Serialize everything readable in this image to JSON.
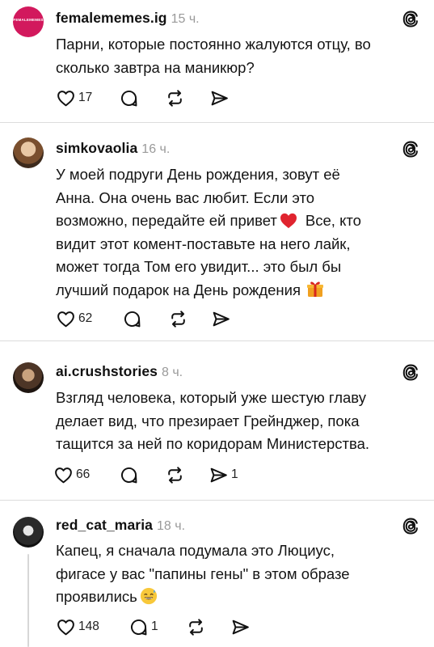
{
  "posts": [
    {
      "username": "femalememes.ig",
      "time": "15 ч.",
      "avatar_text": "FEMALEMEMES",
      "lines": [
        "Парни, которые постоянно жалуются отцу, во",
        "сколько завтра на маникюр?"
      ],
      "likes": "17",
      "replies": "",
      "reposts": "",
      "shares": ""
    },
    {
      "username": "simkovaolia",
      "time": "16 ч.",
      "lines": [
        "У моей подруги День рождения, зовут её",
        "Анна. Она очень вас любит. Если это",
        "возможно, передайте ей привет",
        "видит этот комент-поставьте на него лайк,",
        "может тогда Том его увидит... это был бы",
        "лучший подарок на День рождения"
      ],
      "line3_tail": "Все, кто",
      "likes": "62",
      "replies": "",
      "reposts": "",
      "shares": ""
    },
    {
      "username": "ai.crushstories",
      "time": "8 ч.",
      "lines": [
        "Взгляд человека, который уже шестую главу",
        "делает вид, что презирает Грейнджер, пока",
        "тащится за ней по коридорам Министерства."
      ],
      "likes": "66",
      "replies": "",
      "reposts": "",
      "shares": "1"
    },
    {
      "username": "red_cat_maria",
      "time": "18 ч.",
      "lines": [
        "Капец, я сначала подумала это Люциус,",
        "фигасе у вас \"папины гены\" в этом образе",
        "проявились"
      ],
      "likes": "148",
      "replies": "1",
      "reposts": "",
      "shares": ""
    }
  ],
  "icons": {
    "like": "heart-icon",
    "reply": "comment-icon",
    "repost": "repost-icon",
    "share": "send-icon",
    "brand": "threads-logo-icon"
  },
  "colors": {
    "divider": "#dcdcdc",
    "muted": "#9a9a9a",
    "text": "#141414",
    "heart_emoji": "#e0242f"
  }
}
